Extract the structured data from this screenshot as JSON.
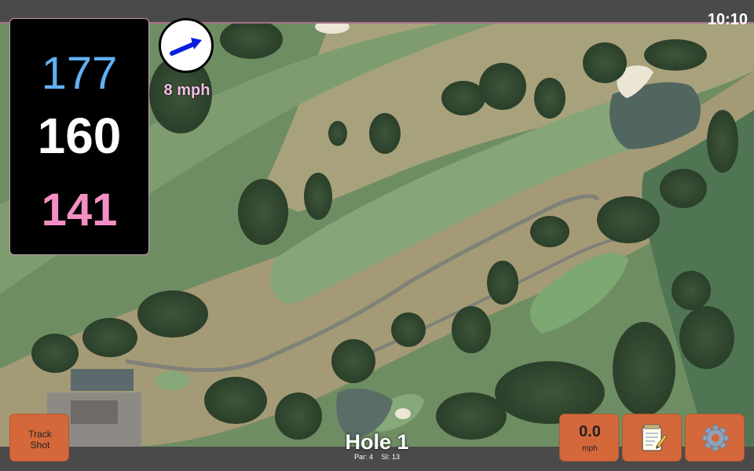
{
  "status": {
    "time": "10:10"
  },
  "distances": {
    "back": "177",
    "middle": "160",
    "front": "141"
  },
  "wind": {
    "speed_label": "8 mph",
    "icon": "wind-direction-arrow-icon"
  },
  "hole": {
    "title": "Hole 1",
    "par_label": "Par: 4",
    "si_label": "SI: 13"
  },
  "buttons": {
    "track_shot_line1": "Track",
    "track_shot_line2": "Shot",
    "speed_value": "0.0",
    "speed_unit": "mph",
    "notes_icon": "notepad-icon",
    "settings_icon": "gear-icon"
  },
  "colors": {
    "back_distance": "#62b0f3",
    "middle_distance": "#ffffff",
    "front_distance": "#f48fc4",
    "button": "#d4683a",
    "wind_label": "#f3bfe4"
  }
}
